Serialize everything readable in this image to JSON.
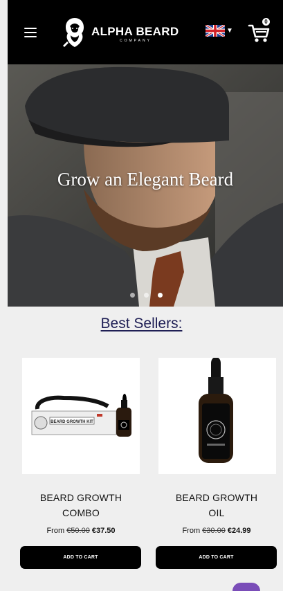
{
  "header": {
    "brand": "ALPHA BEARD",
    "brand_sub": "COMPANY",
    "menu_icon": "hamburger-icon",
    "language_icon": "uk-flag-icon",
    "cart_icon": "cart-icon",
    "cart_count": "0"
  },
  "hero": {
    "title": "Grow an Elegant Beard",
    "slides": 3,
    "active_slide": 3
  },
  "section": {
    "title": "Best Sellers:"
  },
  "products": [
    {
      "title_line1": "BEARD GROWTH",
      "title_line2": "COMBO",
      "price_prefix": "From",
      "price_old": "€50.00",
      "price_new": "€37.50",
      "button": "ADD TO CART",
      "image_text": "BEARD GROWTH KIT"
    },
    {
      "title_line1": "BEARD GROWTH",
      "title_line2": "OIL",
      "price_prefix": "From",
      "price_old": "€30.00",
      "price_new": "€24.99",
      "button": "ADD TO CART"
    }
  ],
  "colors": {
    "header_bg": "#000000",
    "page_bg": "#efefef",
    "section_title": "#1f1f55",
    "button_bg": "#000000",
    "chat_bubble": "#7a4db8"
  }
}
